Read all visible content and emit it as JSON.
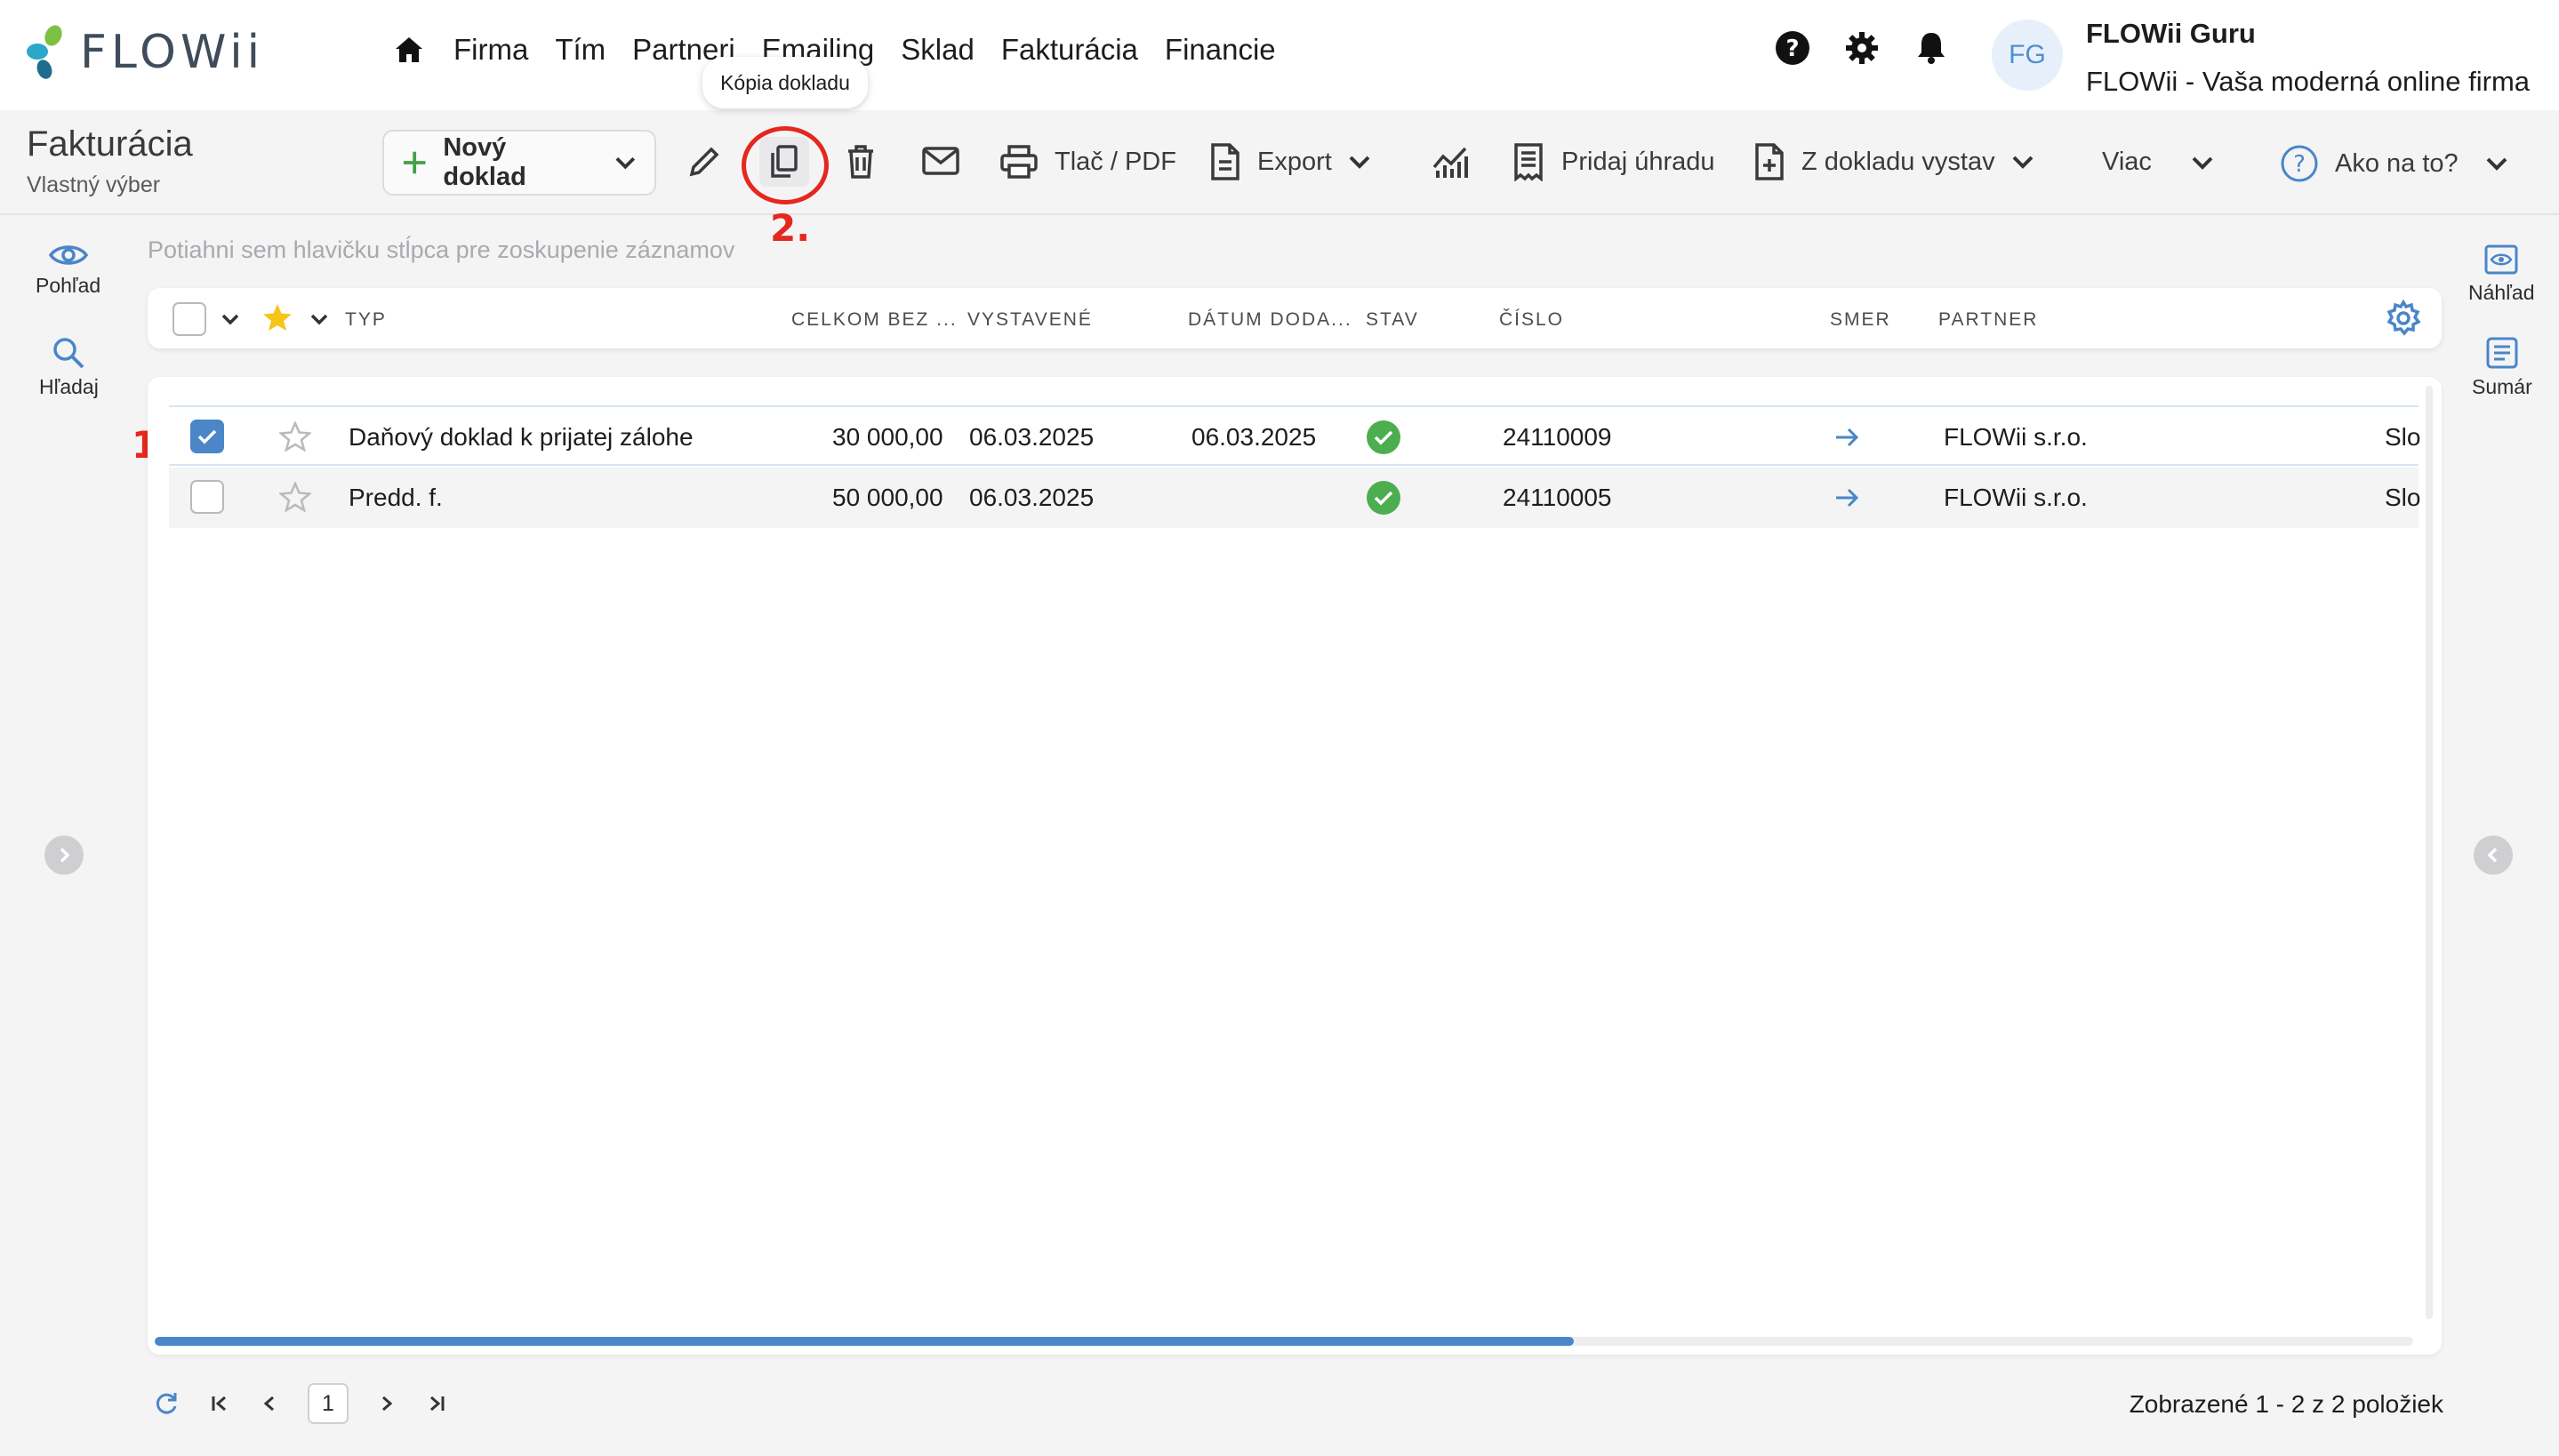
{
  "app": {
    "brand": "FLOWii"
  },
  "nav": {
    "home": "home-icon",
    "items": [
      {
        "label": "Firma"
      },
      {
        "label": "Tím"
      },
      {
        "label": "Partneri"
      },
      {
        "label": "Emailing"
      },
      {
        "label": "Sklad"
      },
      {
        "label": "Fakturácia"
      },
      {
        "label": "Financie"
      }
    ]
  },
  "user": {
    "initials": "FG",
    "name": "FLOWii Guru",
    "company": "FLOWii - Vaša moderná online firma"
  },
  "page": {
    "title": "Fakturácia",
    "subtitle": "Vlastný výber"
  },
  "toolbar": {
    "new_doc": "Nový doklad",
    "print": "Tlač / PDF",
    "export": "Export",
    "add_payment": "Pridaj úhradu",
    "from_doc": "Z dokladu vystav",
    "more": "Viac",
    "help": "Ako na to?",
    "tooltip": "Kópia dokladu"
  },
  "callouts": {
    "one": "1.",
    "two": "2."
  },
  "left_panel": {
    "view": "Pohľad",
    "search": "Hľadaj"
  },
  "right_panel": {
    "preview": "Náhľad",
    "summary": "Sumár"
  },
  "grid": {
    "group_hint": "Potiahni sem hlavičku stĺpca pre zoskupenie záznamov",
    "columns": [
      "TYP",
      "CELKOM BEZ ...",
      "VYSTAVENÉ",
      "DÁTUM DODA...",
      "STAV",
      "ČÍSLO",
      "SMER",
      "PARTNER"
    ],
    "rows": [
      {
        "checked": true,
        "type": "Daňový doklad k prijatej zálohe",
        "total": "30 000,00",
        "issued": "06.03.2025",
        "delivery": "06.03.2025",
        "number": "24110009",
        "partner": "FLOWii s.r.o.",
        "extra": "Slo"
      },
      {
        "checked": false,
        "type": "Predd. f.",
        "total": "50 000,00",
        "issued": "06.03.2025",
        "delivery": "",
        "number": "24110005",
        "partner": "FLOWii s.r.o.",
        "extra": "Slo"
      }
    ]
  },
  "footer": {
    "page": "1",
    "count": "Zobrazené 1 - 2 z 2 položiek"
  },
  "colors": {
    "accent": "#4a86c8",
    "callout": "#e5271d",
    "status_ok": "#4cae4f",
    "new_plus": "#43a047"
  }
}
